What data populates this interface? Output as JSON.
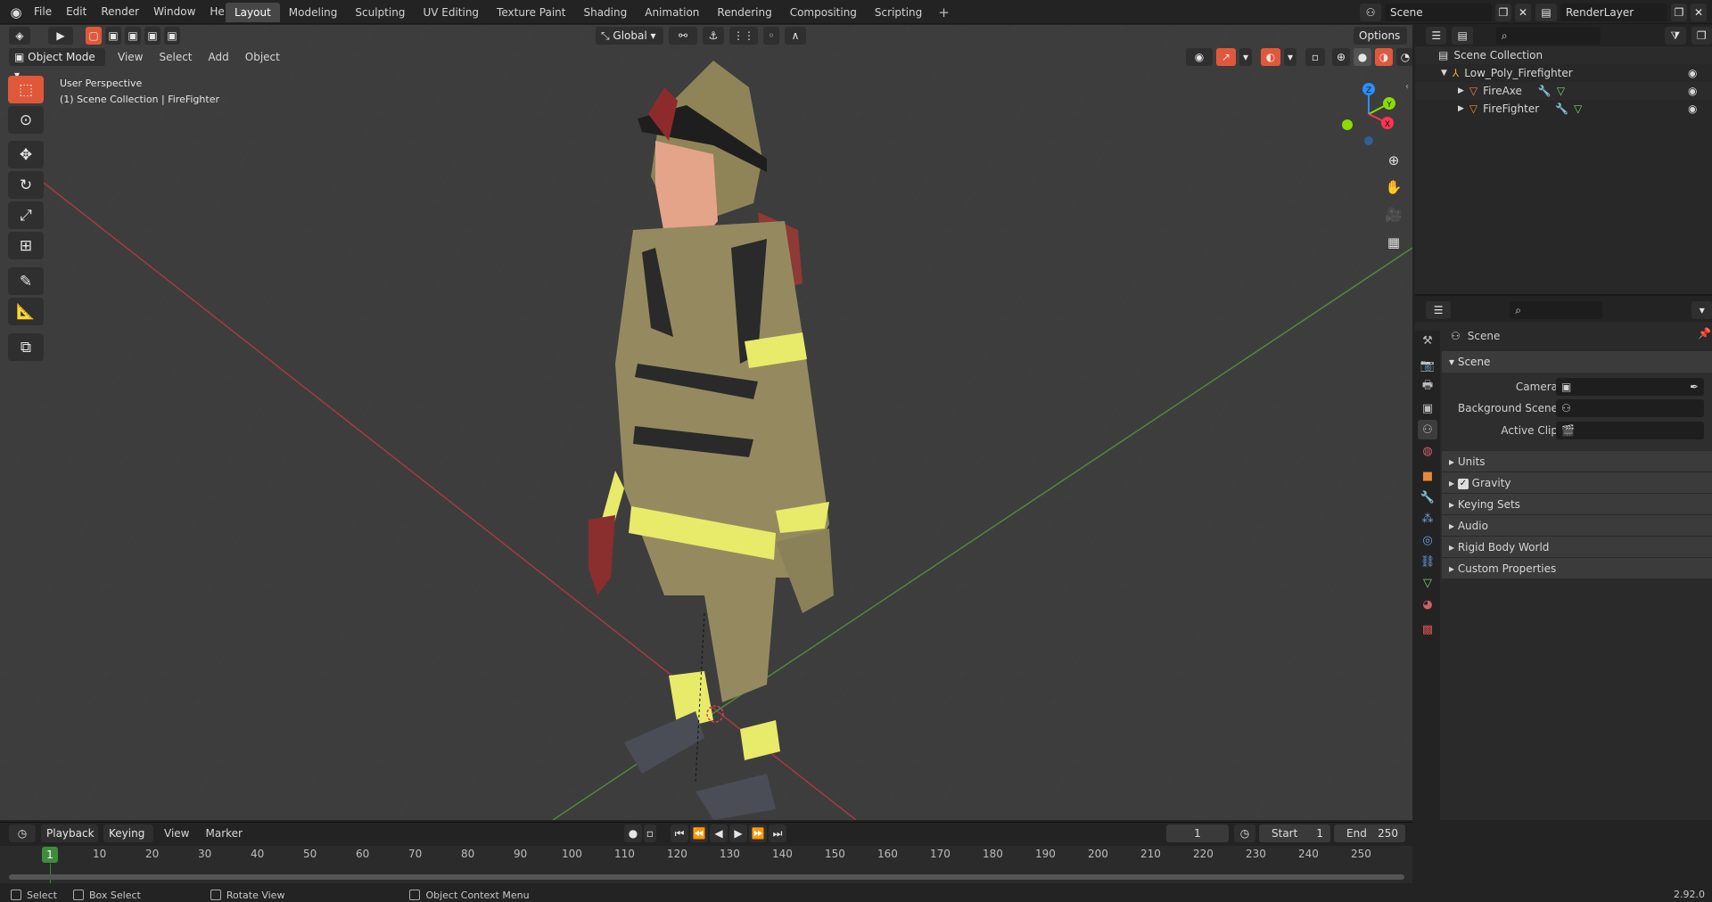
{
  "app": {
    "version": "2.92.0"
  },
  "menu": [
    "File",
    "Edit",
    "Render",
    "Window",
    "Help"
  ],
  "workspaces": [
    "Layout",
    "Modeling",
    "Sculpting",
    "UV Editing",
    "Texture Paint",
    "Shading",
    "Animation",
    "Rendering",
    "Compositing",
    "Scripting"
  ],
  "active_workspace": "Layout",
  "scene_field": "Scene",
  "renderlayer_field": "RenderLayer",
  "viewport": {
    "mode": "Object Mode",
    "menus": [
      "View",
      "Select",
      "Add",
      "Object"
    ],
    "orientation": "Global",
    "options": "Options",
    "overlay_line1": "User Perspective",
    "overlay_line2": "(1) Scene Collection | FireFighter",
    "gizmo_axes": {
      "x": "X",
      "y": "Y",
      "z": "Z"
    }
  },
  "colors": {
    "accent": "#e0583a",
    "x_axis": "#ff3352",
    "y_axis": "#8bdc00",
    "z_axis": "#2890ff",
    "floor": "#3d3d3d"
  },
  "outliner": {
    "root": "Scene Collection",
    "collection": "Low_Poly_Firefighter",
    "objects": [
      "FireAxe",
      "FireFighter"
    ]
  },
  "properties": {
    "context": "Scene",
    "panel": "Scene",
    "fields": [
      {
        "label": "Camera"
      },
      {
        "label": "Background Scene"
      },
      {
        "label": "Active Clip"
      }
    ],
    "sections": [
      "Units",
      "Gravity",
      "Keying Sets",
      "Audio",
      "Rigid Body World",
      "Custom Properties"
    ],
    "gravity_checked": true
  },
  "timeline": {
    "menus": [
      "Playback",
      "Keying",
      "View",
      "Marker"
    ],
    "current_frame": "1",
    "start_label": "Start",
    "start": "1",
    "end_label": "End",
    "end": "250",
    "ticks": [
      "1",
      "10",
      "20",
      "30",
      "40",
      "50",
      "60",
      "70",
      "80",
      "90",
      "100",
      "110",
      "120",
      "130",
      "140",
      "150",
      "160",
      "170",
      "180",
      "190",
      "200",
      "210",
      "220",
      "230",
      "240",
      "250"
    ]
  },
  "status": {
    "items": [
      "Select",
      "Box Select",
      "Rotate View",
      "Object Context Menu"
    ]
  }
}
